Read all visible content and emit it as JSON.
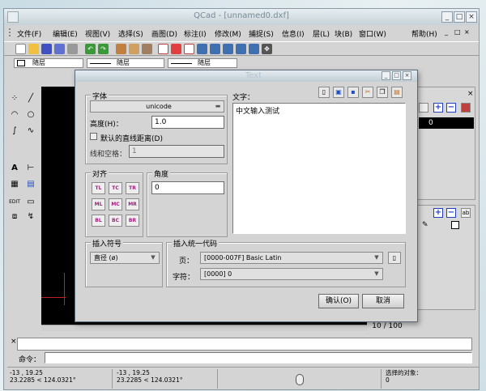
{
  "window": {
    "title": "QCad - [unnamed0.dxf]",
    "minimize": "_",
    "maximize": "□",
    "close": "×"
  },
  "menu": {
    "items": [
      "文件(F)",
      "编辑(E)",
      "视图(V)",
      "选择(S)",
      "画图(D)",
      "标注(I)",
      "修改(M)",
      "捕捉(S)",
      "信息(I)",
      "层(L)",
      "块(B)",
      "窗口(W)"
    ],
    "help": "帮助(H)"
  },
  "layer_bar": {
    "layer": "随层",
    "line_type": "随层",
    "line_width": "随层"
  },
  "right_panel": {
    "layer_zero": "0"
  },
  "dialog": {
    "title": "Text",
    "font_group": "字体",
    "font_value": "unicode",
    "height_label": "高度(H)：",
    "height_value": "1.0",
    "default_spacing_label": "默认的直线距离(D)",
    "line_spacing_label": "线和空格：",
    "line_spacing_value": "1",
    "text_label": "文字：",
    "text_value": "中文输入测试",
    "align_group": "对齐",
    "align_buttons": [
      "TL",
      "TC",
      "TR",
      "ML",
      "MC",
      "MR",
      "BL",
      "BC",
      "BR"
    ],
    "angle_group": "角度",
    "angle_value": "0",
    "symbol_group": "插入符号",
    "symbol_value": "直径 (ø)",
    "unicode_group": "插入统一代码",
    "page_label": "页：",
    "page_value": "[0000-007F] Basic Latin",
    "char_label": "字符：",
    "char_value": "[0000] 0",
    "ok": "确认(O)",
    "cancel": "取消"
  },
  "page_counter": "10 / 100",
  "command": {
    "label": "命令："
  },
  "status": {
    "abs_coord": "-13 , 19.25",
    "abs_polar": "23.2285 < 124.0321°",
    "rel_coord": "-13 , 19.25",
    "rel_polar": "23.2285 < 124.0321°",
    "selected_label": "选择的对象：",
    "selected_value": "0"
  }
}
